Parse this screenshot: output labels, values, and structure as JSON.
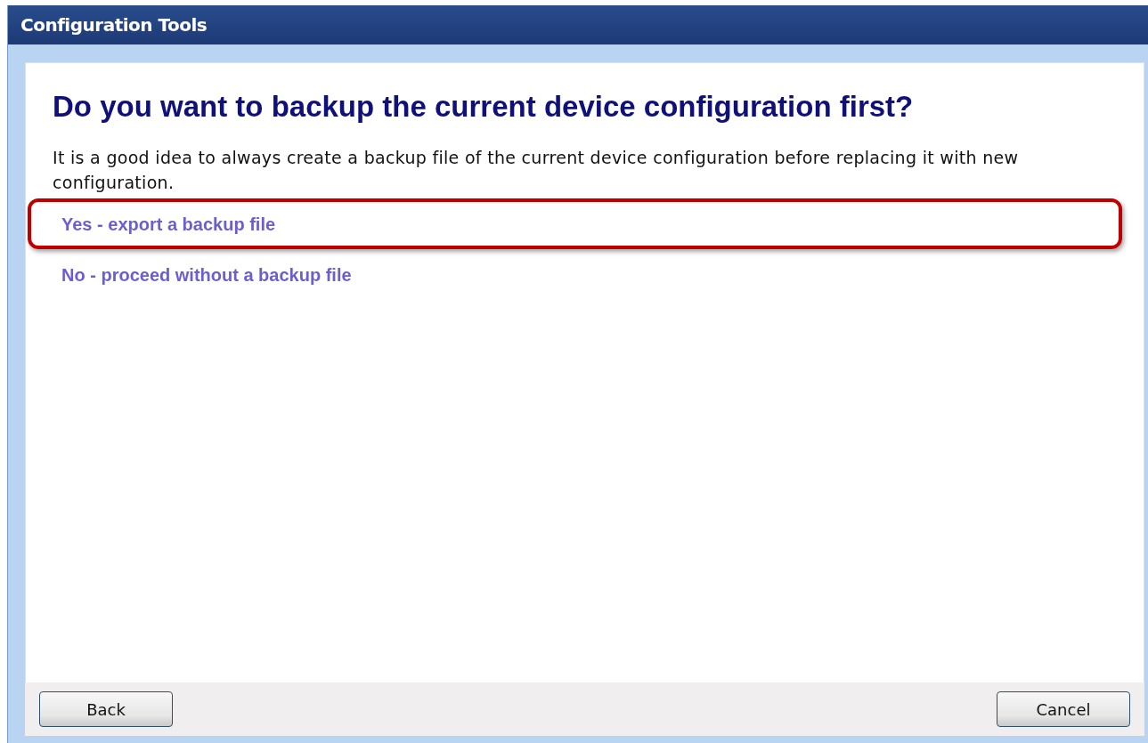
{
  "window": {
    "title": "Configuration Tools"
  },
  "heading": "Do you want to backup the current device configuration first?",
  "description": "It is a good idea to always create a backup file of the current device configuration before replacing it with new configuration.",
  "options": [
    {
      "label": "Yes - export a backup file",
      "highlighted": true
    },
    {
      "label": "No - proceed without a backup file",
      "highlighted": false
    }
  ],
  "buttons": {
    "left": "Back",
    "right": "Cancel"
  }
}
